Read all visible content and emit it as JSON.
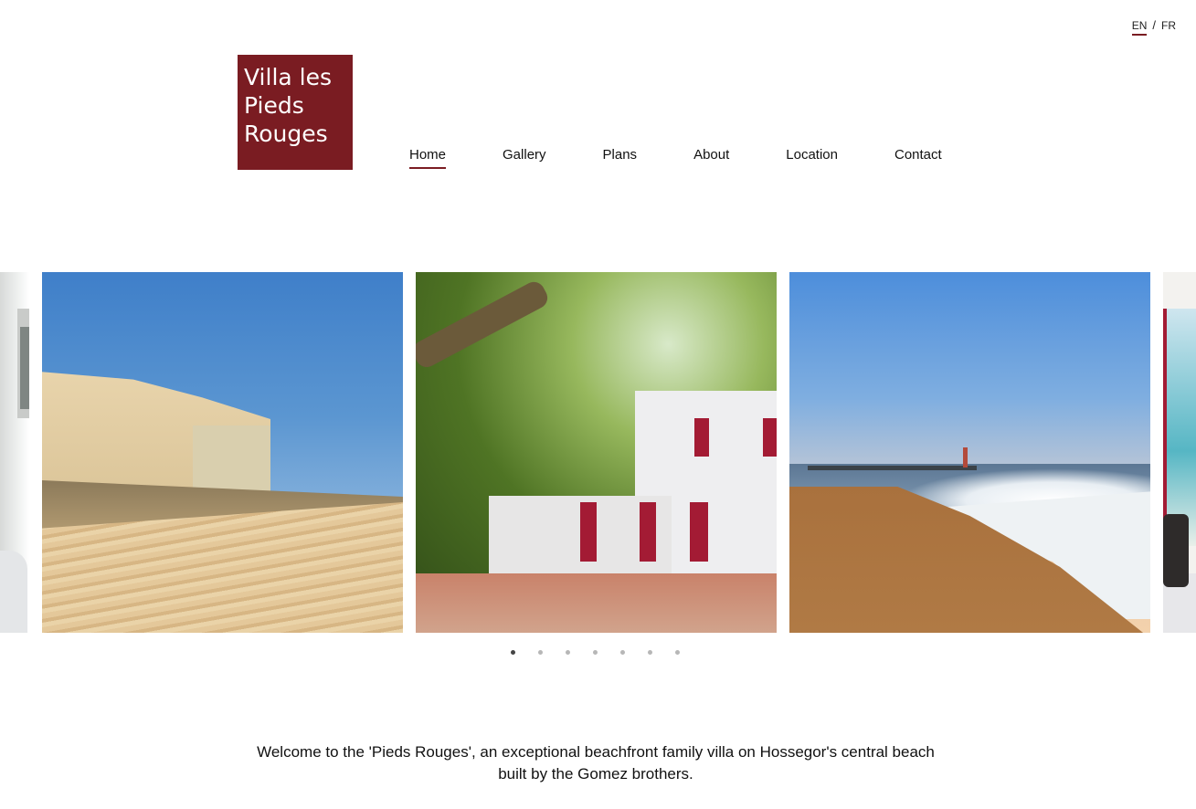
{
  "lang": {
    "options": [
      "EN",
      "FR"
    ],
    "active": "EN",
    "separator": "/"
  },
  "logo": {
    "lines": [
      "Villa les",
      "Pieds",
      "Rouges"
    ],
    "bg_color": "#7a1c22"
  },
  "nav": {
    "items": [
      "Home",
      "Gallery",
      "Plans",
      "About",
      "Location",
      "Contact"
    ],
    "active": "Home"
  },
  "carousel": {
    "slide_count": 7,
    "active_index": 0,
    "visible_slides": [
      "bedroom-interior-partial",
      "beach-villas-and-sand",
      "garden-terrace-with-tree",
      "beach-sunset-waves-lighthouse",
      "living-room-sea-view-partial"
    ]
  },
  "welcome": {
    "text": "Welcome to the 'Pieds Rouges', an exceptional beachfront family villa on Hossegor's central beach built by the Gomez brothers."
  },
  "colors": {
    "accent": "#7a1c22"
  }
}
